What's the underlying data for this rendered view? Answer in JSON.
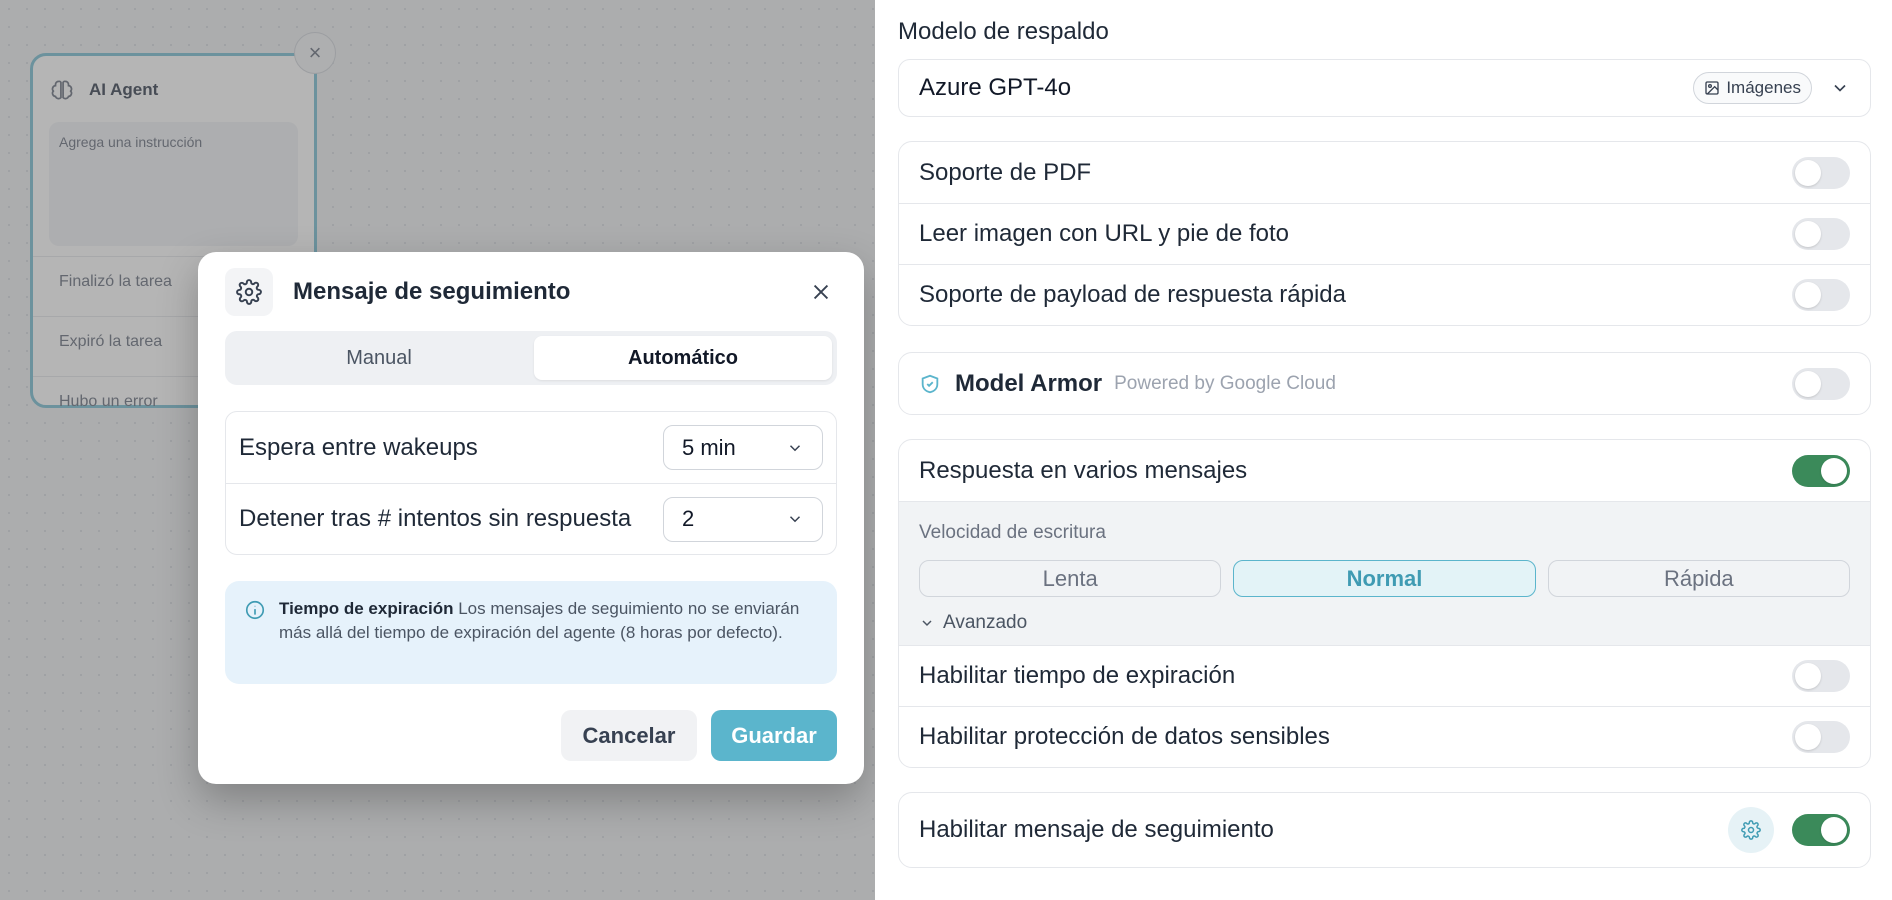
{
  "canvas": {
    "node": {
      "title": "AI Agent",
      "instruction_placeholder": "Agrega una instrucción",
      "exits": [
        "Finalizó la tarea",
        "Expiró la tarea",
        "Hubo un error"
      ],
      "close_glyph": "×"
    }
  },
  "modal": {
    "title": "Mensaje de seguimiento",
    "tabs": [
      {
        "label": "Manual",
        "active": false
      },
      {
        "label": "Automático",
        "active": true
      }
    ],
    "settings": [
      {
        "label": "Espera entre wakeups",
        "value": "5 min"
      },
      {
        "label": "Detener tras # intentos sin respuesta",
        "value": "2"
      }
    ],
    "info": {
      "title": "Tiempo de expiración",
      "text": " Los mensajes de seguimiento no se enviarán más allá del tiempo de expiración del agente (8 horas por defecto)."
    },
    "cancel_label": "Cancelar",
    "save_label": "Guardar"
  },
  "panel": {
    "fallback_label": "Modelo de respaldo",
    "fallback_model": "Azure GPT-4o",
    "fallback_chip": "Imágenes",
    "capabilities": [
      {
        "label": "Soporte de PDF",
        "on": false
      },
      {
        "label": "Leer imagen con URL y pie de foto",
        "on": false
      },
      {
        "label": "Soporte de payload de respuesta rápida",
        "on": false
      }
    ],
    "armor": {
      "title": "Model Armor",
      "subtitle": "Powered by Google Cloud",
      "on": false
    },
    "multi_message": {
      "label": "Respuesta en varios mensajes",
      "on": true,
      "speed_label": "Velocidad de escritura",
      "speeds": [
        {
          "label": "Lenta",
          "active": false
        },
        {
          "label": "Normal",
          "active": true
        },
        {
          "label": "Rápida",
          "active": false
        }
      ],
      "advanced_label": "Avanzado"
    },
    "options": [
      {
        "label": "Habilitar tiempo de expiración",
        "on": false
      },
      {
        "label": "Habilitar protección de datos sensibles",
        "on": false
      }
    ],
    "follow_up": {
      "label": "Habilitar mensaje de seguimiento",
      "on": true
    }
  },
  "colors": {
    "accent": "#5bb5cc",
    "toggle_on": "#3b8a5a"
  }
}
